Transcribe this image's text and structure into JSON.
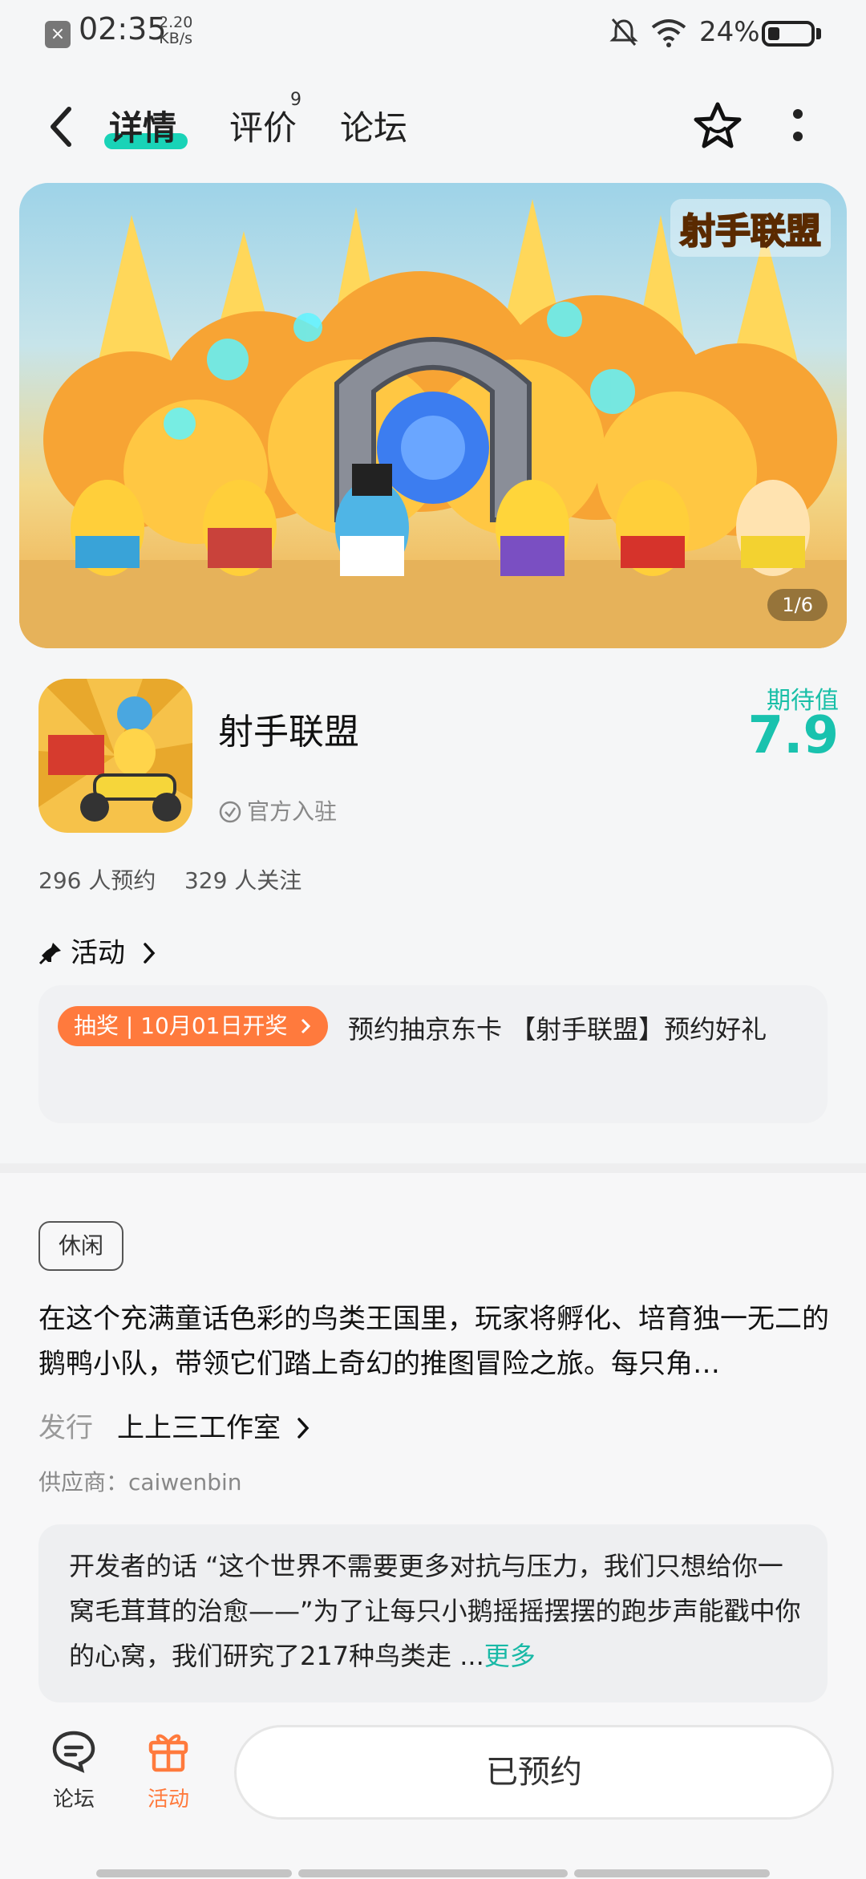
{
  "status_bar": {
    "time": "02:35",
    "speed_value": "2.20",
    "speed_unit": "KB/s",
    "battery": "24%",
    "battery_level": 0.24,
    "icons": [
      "close-notify-icon",
      "mute-bell-icon",
      "wifi-icon",
      "battery-icon"
    ]
  },
  "nav": {
    "back_icon": "chevron-left-icon",
    "tabs": [
      {
        "label": "详情",
        "active": true
      },
      {
        "label": "评价",
        "badge": "9",
        "active": false
      },
      {
        "label": "论坛",
        "active": false
      }
    ],
    "favorite_icon": "star-icon",
    "more_icon": "more-vertical-icon"
  },
  "banner": {
    "logo_text": "射手联盟",
    "counter": "1/6"
  },
  "app": {
    "name": "射手联盟",
    "official": "官方入驻",
    "expect_label": "期待值",
    "expect_score": "7.9",
    "stats": "296 人预约    329 人关注"
  },
  "activity": {
    "title": "活动",
    "tag": "抽奖 | 10月01日开奖",
    "text": "预约抽京东卡 【射手联盟】预约好礼"
  },
  "details": {
    "category_tag": "休闲",
    "description": "在这个充满童话色彩的鸟类王国里，玩家将孵化、培育独一无二的鹅鸭小队，带领它们踏上奇幻的推图冒险之旅。每只角…",
    "publisher_label": "发行",
    "publisher": "上上三工作室",
    "supplier": "供应商：caiwenbin",
    "developer_note": "开发者的话 “这个世界不需要更多对抗与压力，我们只想给你一窝毛茸茸的治愈——”为了让每只小鹅摇摇摆摆的跑步声能戳中你的心窝，我们研究了217种鸟类走 ...",
    "more": "更多"
  },
  "bottom_bar": {
    "forum_label": "论坛",
    "activity_label": "活动",
    "reserve_button": "已预约"
  },
  "colors": {
    "accent": "#19c2ae",
    "orange": "#ff7a3d"
  }
}
